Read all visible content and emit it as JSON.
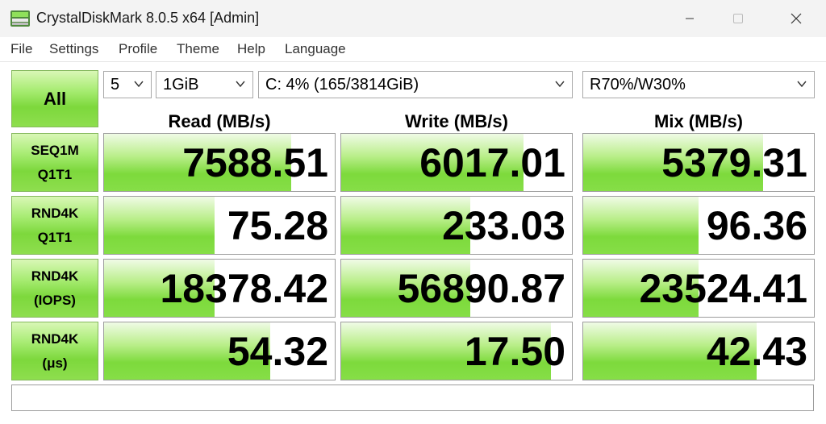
{
  "window": {
    "title": "CrystalDiskMark 8.0.5 x64 [Admin]",
    "minimize_icon": "minimize-icon",
    "maximize_icon": "maximize-icon",
    "close_icon": "close-icon"
  },
  "menu": [
    "File",
    "Settings",
    "Profile",
    "Theme",
    "Help",
    "Language"
  ],
  "controls": {
    "all_button": "All",
    "count": "5",
    "size": "1GiB",
    "drive": "C: 4% (165/3814GiB)",
    "mix": "R70%/W30%"
  },
  "columns": [
    "Read (MB/s)",
    "Write (MB/s)",
    "Mix (MB/s)"
  ],
  "rows": [
    {
      "line1": "SEQ1M",
      "line2": "Q1T1",
      "read": {
        "value": "7588.51",
        "fill": 0.81
      },
      "write": {
        "value": "6017.01",
        "fill": 0.79
      },
      "mix": {
        "value": "5379.31",
        "fill": 0.78
      }
    },
    {
      "line1": "RND4K",
      "line2": "Q1T1",
      "read": {
        "value": "75.28",
        "fill": 0.48
      },
      "write": {
        "value": "233.03",
        "fill": 0.56
      },
      "mix": {
        "value": "96.36",
        "fill": 0.5
      }
    },
    {
      "line1": "RND4K",
      "line2": "(IOPS)",
      "read": {
        "value": "18378.42",
        "fill": 0.48
      },
      "write": {
        "value": "56890.87",
        "fill": 0.56
      },
      "mix": {
        "value": "23524.41",
        "fill": 0.5
      }
    },
    {
      "line1": "RND4K",
      "line2": "(μs)",
      "read": {
        "value": "54.32",
        "fill": 0.72
      },
      "write": {
        "value": "17.50",
        "fill": 0.91
      },
      "mix": {
        "value": "42.43",
        "fill": 0.75
      }
    }
  ],
  "status": ""
}
